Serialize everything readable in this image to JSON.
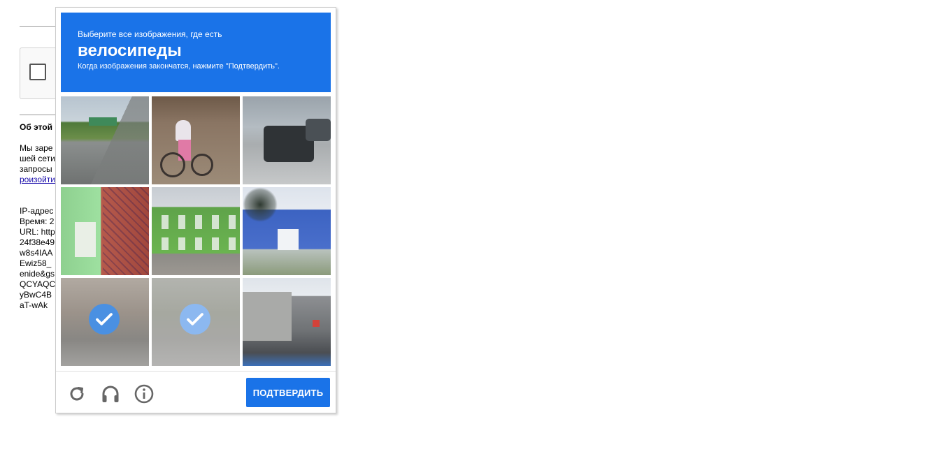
{
  "background_page": {
    "heading": "Об этой",
    "paragraph_lines": [
      "Мы заре",
      "шей сети",
      "запросы"
    ],
    "link_text": "роизойти",
    "details_lines": [
      "IP-адрес",
      "Время: 2",
      "URL: http",
      "24f38e49",
      "w8s4IAA",
      "Ewiz58_",
      "enide&gs",
      "QCYAQC",
      "yBwC4B",
      "aT-wAk"
    ]
  },
  "captcha": {
    "instruction": "Выберите все изображения, где есть",
    "keyword": "велосипеды",
    "hint": "Когда изображения закончатся, нажмите \"Подтвердить\".",
    "tiles": [
      {
        "subject": "road-scene",
        "selected": false
      },
      {
        "subject": "child-with-bicycle",
        "selected": false
      },
      {
        "subject": "parked-car",
        "selected": false
      },
      {
        "subject": "tiled-building-closeup",
        "selected": false
      },
      {
        "subject": "green-house",
        "selected": false
      },
      {
        "subject": "blue-building",
        "selected": false
      },
      {
        "subject": "bicycles-street",
        "selected": true
      },
      {
        "subject": "cyclist-street",
        "selected": true
      },
      {
        "subject": "narrow-street",
        "selected": false
      }
    ],
    "footer": {
      "reload_icon": "reload-icon",
      "audio_icon": "headphones-icon",
      "info_icon": "info-icon",
      "verify_label": "ПОДТВЕРДИТЬ"
    },
    "colors": {
      "accent": "#1a73e8",
      "check": "#4a90e2"
    }
  }
}
